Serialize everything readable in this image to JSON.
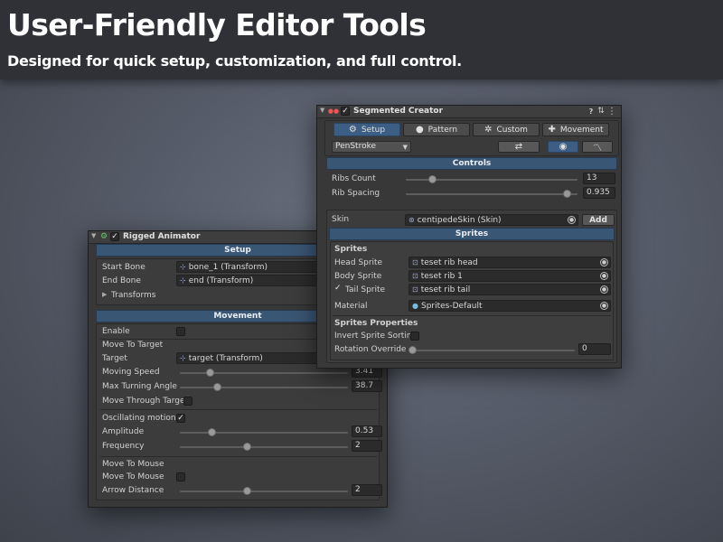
{
  "hero": {
    "title": "User-Friendly Editor Tools",
    "subtitle": "Designed for quick setup, customization, and full control."
  },
  "rigged": {
    "title": "Rigged Animator",
    "setup": {
      "header": "Setup",
      "start_bone_label": "Start Bone",
      "start_bone_value": "bone_1 (Transform)",
      "end_bone_label": "End Bone",
      "end_bone_value": "end (Transform)",
      "transforms_label": "Transforms"
    },
    "movement": {
      "header": "Movement",
      "enable_label": "Enable",
      "enable_checked": false,
      "move_to_target_header": "Move To Target",
      "target_label": "Target",
      "target_value": "target (Transform)",
      "moving_speed_label": "Moving Speed",
      "moving_speed_value": "3.41",
      "moving_speed_level": 0.18,
      "max_turning_label": "Max Turning Angle",
      "max_turning_value": "38.7",
      "max_turning_level": 0.22,
      "move_through_label": "Move Through Target",
      "move_through_checked": false,
      "oscillating_label": "Oscillating motion",
      "oscillating_checked": true,
      "amplitude_label": "Amplitude",
      "amplitude_value": "0.53",
      "amplitude_level": 0.19,
      "frequency_label": "Frequency",
      "frequency_value": "2",
      "frequency_level": 0.4,
      "move_to_mouse_header": "Move To Mouse",
      "move_to_mouse_label": "Move To Mouse",
      "move_to_mouse_checked": false,
      "arrow_distance_label": "Arrow Distance",
      "arrow_distance_value": "2",
      "arrow_distance_level": 0.4
    }
  },
  "segmented": {
    "title": "Segmented Creator",
    "tabs": [
      "Setup",
      "Pattern",
      "Custom",
      "Movement"
    ],
    "dropdown_value": "PenStroke",
    "controls": {
      "header": "Controls",
      "ribs_count_label": "Ribs Count",
      "ribs_count_value": "13",
      "ribs_count_level": 0.15,
      "rib_spacing_label": "Rib Spacing",
      "rib_spacing_value": "0.935",
      "rib_spacing_level": 0.935
    },
    "skin": {
      "label": "Skin",
      "value": "centipedeSkin (Skin)",
      "add_label": "Add"
    },
    "sprites": {
      "header": "Sprites",
      "group_label": "Sprites",
      "head_label": "Head Sprite",
      "head_value": "teset rib head",
      "body_label": "Body Sprite",
      "body_value": "teset rib 1",
      "tail_label": "Tail Sprite",
      "tail_checked": true,
      "tail_value": "teset rib tail",
      "material_label": "Material",
      "material_value": "Sprites-Default",
      "props_label": "Sprites Properties",
      "invert_label": "Invert Sprite Sorting",
      "invert_checked": false,
      "rotation_label": "Rotation Override",
      "rotation_value": "0",
      "rotation_level": 0.0
    }
  },
  "colors": {
    "accent": "#3c5e84",
    "section_header": "#3a5675",
    "panel_bg": "#383838",
    "hero_bg": "#2f3136"
  },
  "icons": [
    "collapse-triangle-icon",
    "script-icon",
    "help-icon",
    "settings-icon",
    "kebab-menu-icon",
    "gear-icon",
    "pattern-icon",
    "puzzle-icon",
    "move-icon",
    "refresh-icon",
    "eye-icon",
    "graph-icon",
    "object-picker-icon",
    "transform-icon",
    "skin-icon",
    "sprite-icon",
    "material-icon"
  ]
}
